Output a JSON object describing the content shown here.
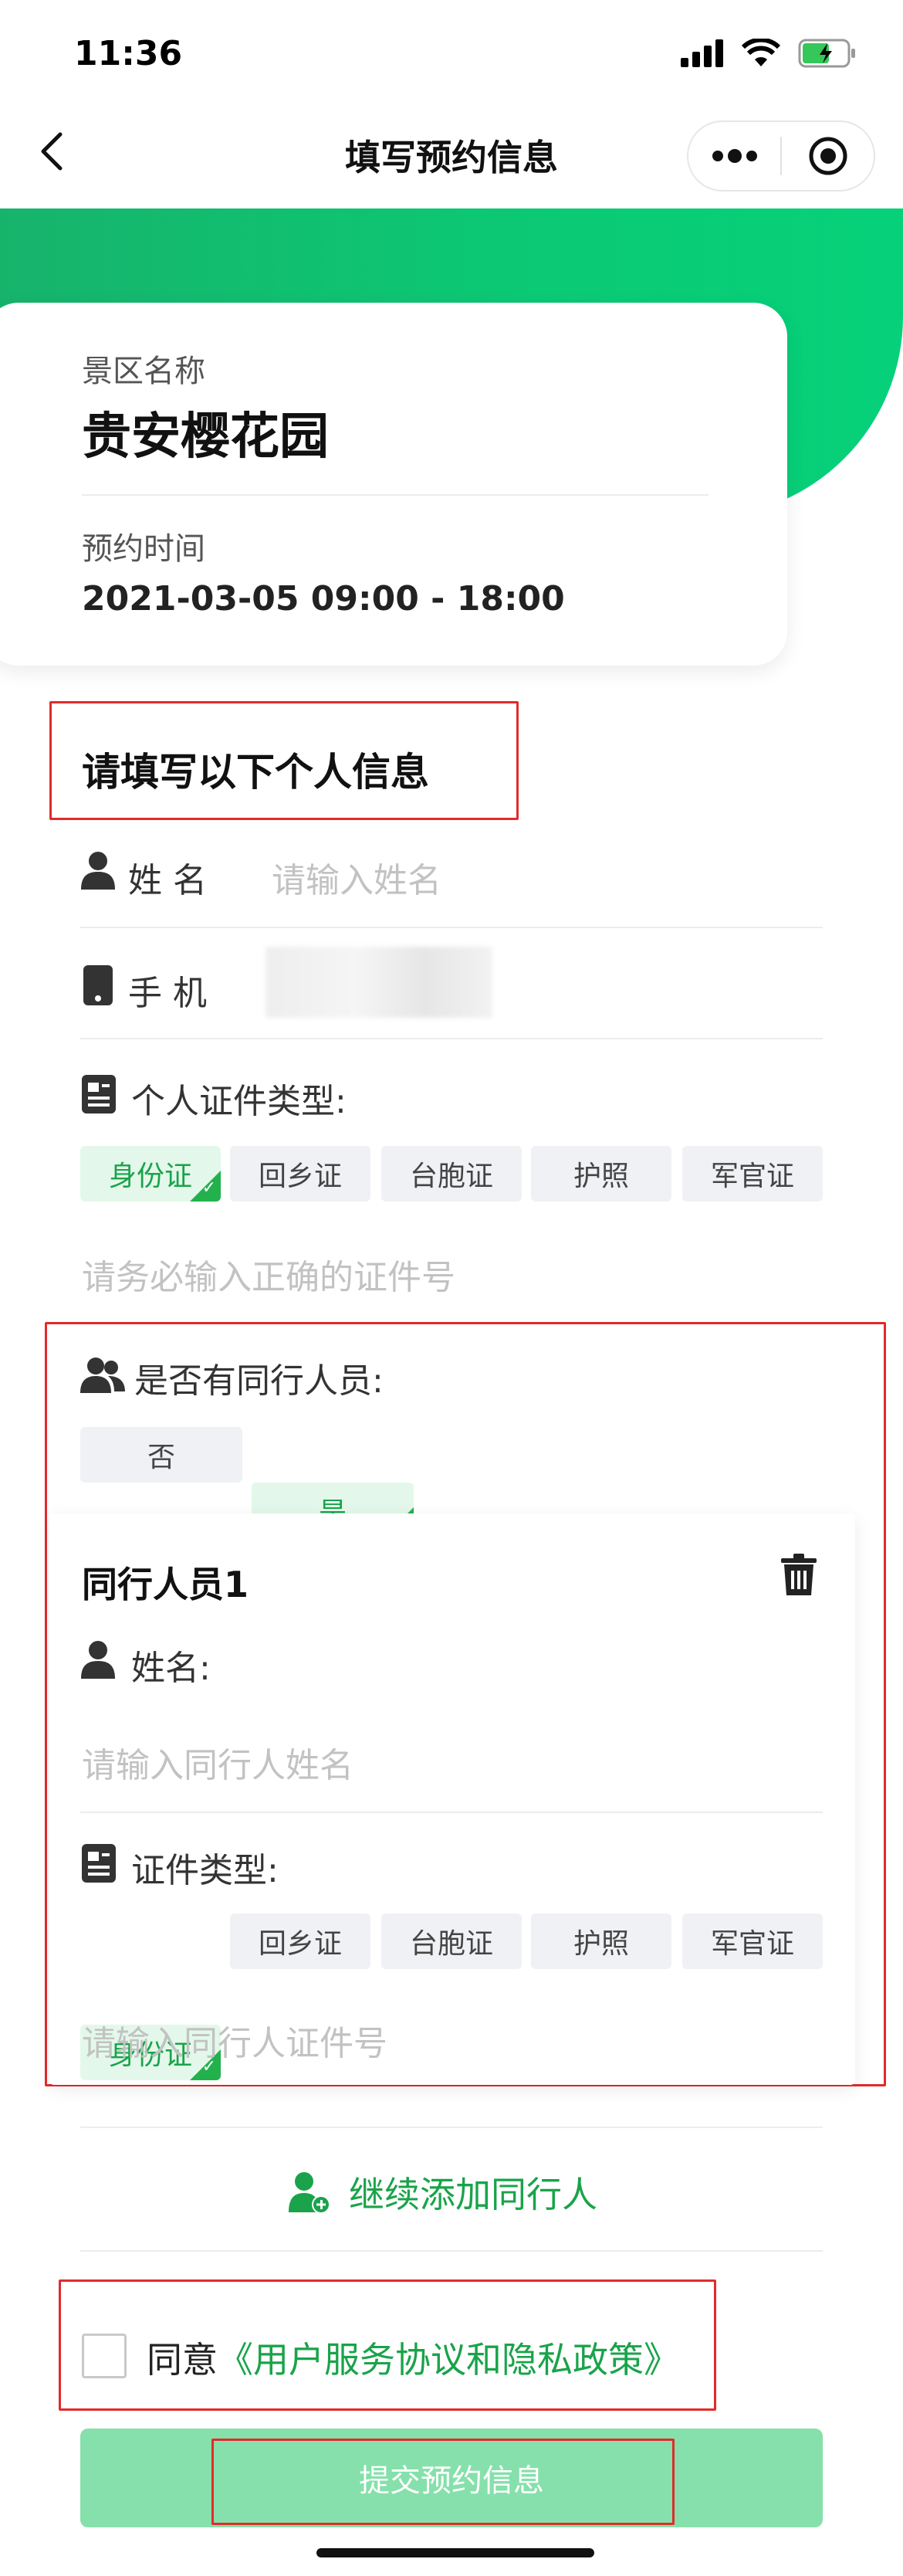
{
  "status": {
    "time": "11:36"
  },
  "nav": {
    "title": "填写预约信息"
  },
  "info_card": {
    "scenic_label": "景区名称",
    "scenic_name": "贵安樱花园",
    "time_label": "预约时间",
    "time_value": "2021-03-05  09:00 - 18:00"
  },
  "form": {
    "section_title": "请填写以下个人信息",
    "name_label": "姓 名",
    "name_placeholder": "请输入姓名",
    "phone_label": "手 机",
    "id_type_label": "个人证件类型:",
    "id_types": [
      "身份证",
      "回乡证",
      "台胞证",
      "护照",
      "军官证"
    ],
    "id_selected": "身份证",
    "id_placeholder": "请务必输入正确的证件号",
    "companion_q": "是否有同行人员:",
    "companion_opts": [
      "否",
      "是"
    ],
    "companion_selected": "是"
  },
  "companion": {
    "title": "同行人员1",
    "name_label": "姓名:",
    "name_placeholder": "请输入同行人姓名",
    "id_type_label": "证件类型:",
    "id_types": [
      "身份证",
      "回乡证",
      "台胞证",
      "护照",
      "军官证"
    ],
    "id_placeholder": "请输入同行人证件号"
  },
  "add_companion": "继续添加同行人",
  "agree": {
    "prefix": "同意",
    "link": "《用户服务协议和隐私政策》"
  },
  "submit_label": "提交预约信息",
  "colors": {
    "brand": "#1aa34a",
    "annotation": "#e12b2b",
    "submit": "#86e0ab"
  }
}
